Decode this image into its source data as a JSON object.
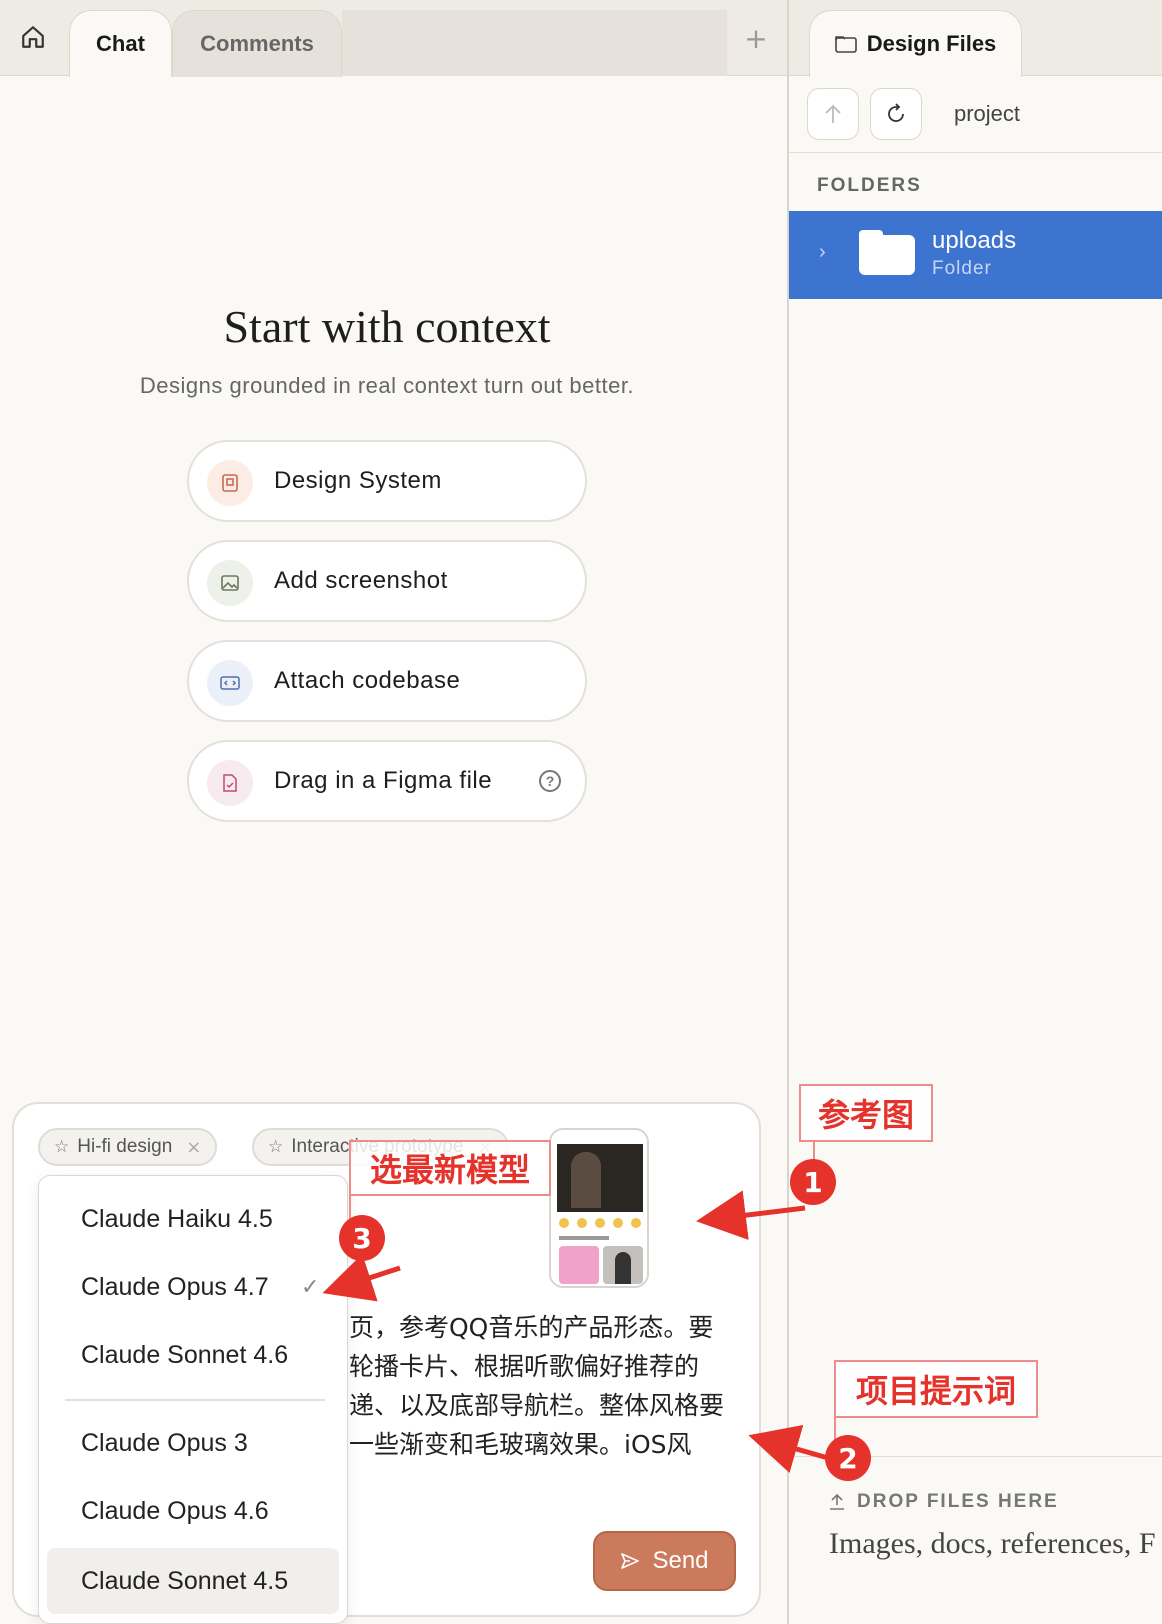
{
  "tabs": {
    "chat": "Chat",
    "comments": "Comments",
    "add": "+"
  },
  "right_panel": {
    "tab_title": "Design Files",
    "path": "project",
    "folders_header": "FOLDERS",
    "folder": {
      "name": "uploads",
      "type": "Folder"
    },
    "drop_header": "DROP FILES HERE",
    "drop_desc": "Images, docs, references, F"
  },
  "main": {
    "title": "Start with context",
    "subtitle": "Designs grounded in real context turn out better.",
    "buttons": [
      {
        "label": "Design System",
        "icon": "book-icon",
        "color": "#c96b4f"
      },
      {
        "label": "Add screenshot",
        "icon": "image-icon",
        "color": "#6b7a5c"
      },
      {
        "label": "Attach codebase",
        "icon": "code-icon",
        "color": "#4f6fb0"
      },
      {
        "label": "Drag in a Figma file",
        "icon": "file-icon",
        "color": "#c04a70"
      }
    ]
  },
  "composer": {
    "chips": [
      {
        "label": "Hi-fi design"
      },
      {
        "label": "Interactive prototype"
      }
    ],
    "prompt_lines": [
      "页，参考QQ音乐的产品形态。要",
      "轮播卡片、根据听歌偏好推荐的",
      "递、以及底部导航栏。整体风格要",
      "一些渐变和毛玻璃效果。iOS风"
    ],
    "send_label": "Send"
  },
  "model_menu": {
    "items": [
      {
        "label": "Claude Haiku 4.5",
        "selected": false
      },
      {
        "label": "Claude Opus 4.7",
        "selected": true
      },
      {
        "label": "Claude Sonnet 4.6",
        "selected": false
      },
      {
        "label": "Claude Opus 3",
        "selected": false
      },
      {
        "label": "Claude Opus 4.6",
        "selected": false
      },
      {
        "label": "Claude Sonnet 4.5",
        "selected": false,
        "hovered": true
      }
    ],
    "check_mark": "✓"
  },
  "annotations": {
    "ref_image": "参考图",
    "latest_model": "选最新模型",
    "project_prompt": "项目提示词",
    "num1": "1",
    "num2": "2",
    "num3": "3"
  },
  "colors": {
    "accent": "#cc7a5c",
    "selection": "#3d74d0",
    "annotation": "#e5322a"
  }
}
